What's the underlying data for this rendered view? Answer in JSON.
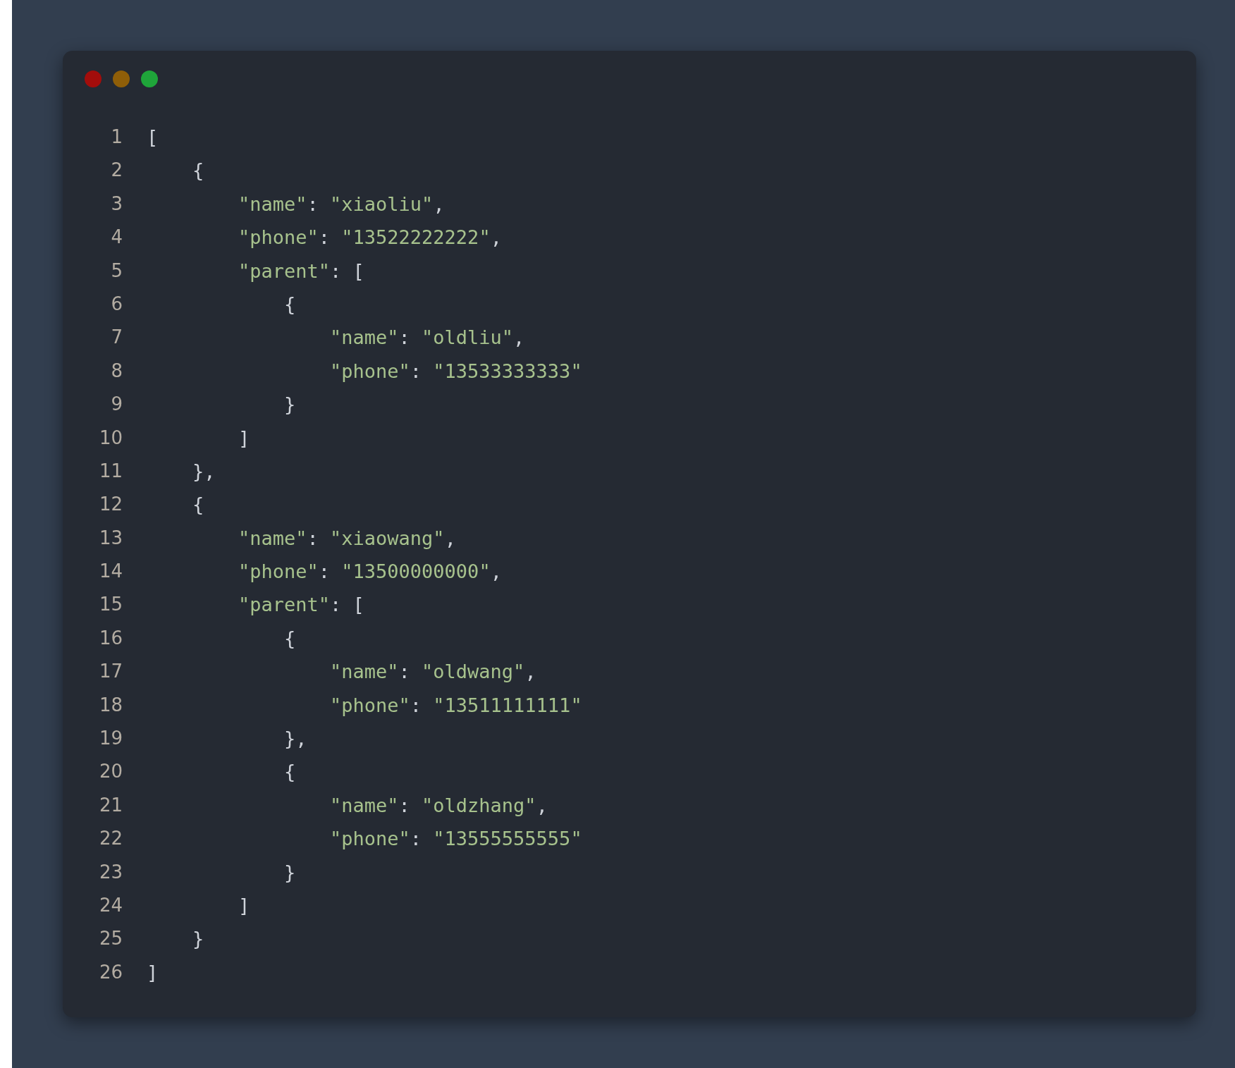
{
  "window": {
    "controls": [
      {
        "color": "#a30d0b"
      },
      {
        "color": "#8f5e08"
      },
      {
        "color": "#1fa53a"
      }
    ]
  },
  "code": {
    "lines": [
      {
        "number": "1",
        "tokens": [
          {
            "kind": "punct",
            "text": "["
          }
        ],
        "children": [
          {
            "number": "2",
            "tokens": [
              {
                "kind": "punct",
                "text": "{"
              }
            ],
            "children": [
              {
                "number": "3",
                "tokens": [
                  {
                    "kind": "string",
                    "text": "\"name\""
                  },
                  {
                    "kind": "punct",
                    "text": ": "
                  },
                  {
                    "kind": "string",
                    "text": "\"xiaoliu\""
                  },
                  {
                    "kind": "punct",
                    "text": ","
                  }
                ]
              },
              {
                "number": "4",
                "tokens": [
                  {
                    "kind": "string",
                    "text": "\"phone\""
                  },
                  {
                    "kind": "punct",
                    "text": ": "
                  },
                  {
                    "kind": "string",
                    "text": "\"13522222222\""
                  },
                  {
                    "kind": "punct",
                    "text": ","
                  }
                ]
              },
              {
                "number": "5",
                "tokens": [
                  {
                    "kind": "string",
                    "text": "\"parent\""
                  },
                  {
                    "kind": "punct",
                    "text": ": ["
                  }
                ],
                "children": [
                  {
                    "number": "6",
                    "tokens": [
                      {
                        "kind": "punct",
                        "text": "{"
                      }
                    ],
                    "children": [
                      {
                        "number": "7",
                        "tokens": [
                          {
                            "kind": "string",
                            "text": "\"name\""
                          },
                          {
                            "kind": "punct",
                            "text": ": "
                          },
                          {
                            "kind": "string",
                            "text": "\"oldliu\""
                          },
                          {
                            "kind": "punct",
                            "text": ","
                          }
                        ]
                      },
                      {
                        "number": "8",
                        "tokens": [
                          {
                            "kind": "string",
                            "text": "\"phone\""
                          },
                          {
                            "kind": "punct",
                            "text": ": "
                          },
                          {
                            "kind": "string",
                            "text": "\"13533333333\""
                          }
                        ]
                      }
                    ]
                  },
                  {
                    "number": "9",
                    "tokens": [
                      {
                        "kind": "punct",
                        "text": "}"
                      }
                    ]
                  }
                ]
              },
              {
                "number": "10",
                "tokens": [
                  {
                    "kind": "punct",
                    "text": "]"
                  }
                ]
              }
            ]
          },
          {
            "number": "11",
            "tokens": [
              {
                "kind": "punct",
                "text": "},"
              }
            ]
          },
          {
            "number": "12",
            "tokens": [
              {
                "kind": "punct",
                "text": "{"
              }
            ],
            "children": [
              {
                "number": "13",
                "tokens": [
                  {
                    "kind": "string",
                    "text": "\"name\""
                  },
                  {
                    "kind": "punct",
                    "text": ": "
                  },
                  {
                    "kind": "string",
                    "text": "\"xiaowang\""
                  },
                  {
                    "kind": "punct",
                    "text": ","
                  }
                ]
              },
              {
                "number": "14",
                "tokens": [
                  {
                    "kind": "string",
                    "text": "\"phone\""
                  },
                  {
                    "kind": "punct",
                    "text": ": "
                  },
                  {
                    "kind": "string",
                    "text": "\"13500000000\""
                  },
                  {
                    "kind": "punct",
                    "text": ","
                  }
                ]
              },
              {
                "number": "15",
                "tokens": [
                  {
                    "kind": "string",
                    "text": "\"parent\""
                  },
                  {
                    "kind": "punct",
                    "text": ": ["
                  }
                ],
                "children": [
                  {
                    "number": "16",
                    "tokens": [
                      {
                        "kind": "punct",
                        "text": "{"
                      }
                    ],
                    "children": [
                      {
                        "number": "17",
                        "tokens": [
                          {
                            "kind": "string",
                            "text": "\"name\""
                          },
                          {
                            "kind": "punct",
                            "text": ": "
                          },
                          {
                            "kind": "string",
                            "text": "\"oldwang\""
                          },
                          {
                            "kind": "punct",
                            "text": ","
                          }
                        ]
                      },
                      {
                        "number": "18",
                        "tokens": [
                          {
                            "kind": "string",
                            "text": "\"phone\""
                          },
                          {
                            "kind": "punct",
                            "text": ": "
                          },
                          {
                            "kind": "string",
                            "text": "\"13511111111\""
                          }
                        ]
                      }
                    ]
                  },
                  {
                    "number": "19",
                    "tokens": [
                      {
                        "kind": "punct",
                        "text": "},"
                      }
                    ]
                  },
                  {
                    "number": "20",
                    "tokens": [
                      {
                        "kind": "punct",
                        "text": "{"
                      }
                    ],
                    "children": [
                      {
                        "number": "21",
                        "tokens": [
                          {
                            "kind": "string",
                            "text": "\"name\""
                          },
                          {
                            "kind": "punct",
                            "text": ": "
                          },
                          {
                            "kind": "string",
                            "text": "\"oldzhang\""
                          },
                          {
                            "kind": "punct",
                            "text": ","
                          }
                        ]
                      },
                      {
                        "number": "22",
                        "tokens": [
                          {
                            "kind": "string",
                            "text": "\"phone\""
                          },
                          {
                            "kind": "punct",
                            "text": ": "
                          },
                          {
                            "kind": "string",
                            "text": "\"13555555555\""
                          }
                        ]
                      }
                    ]
                  },
                  {
                    "number": "23",
                    "tokens": [
                      {
                        "kind": "punct",
                        "text": "}"
                      }
                    ]
                  }
                ]
              },
              {
                "number": "24",
                "tokens": [
                  {
                    "kind": "punct",
                    "text": "]"
                  }
                ]
              }
            ]
          },
          {
            "number": "25",
            "tokens": [
              {
                "kind": "punct",
                "text": "}"
              }
            ]
          }
        ]
      },
      {
        "number": "26",
        "tokens": [
          {
            "kind": "punct",
            "text": "]"
          }
        ]
      }
    ]
  }
}
